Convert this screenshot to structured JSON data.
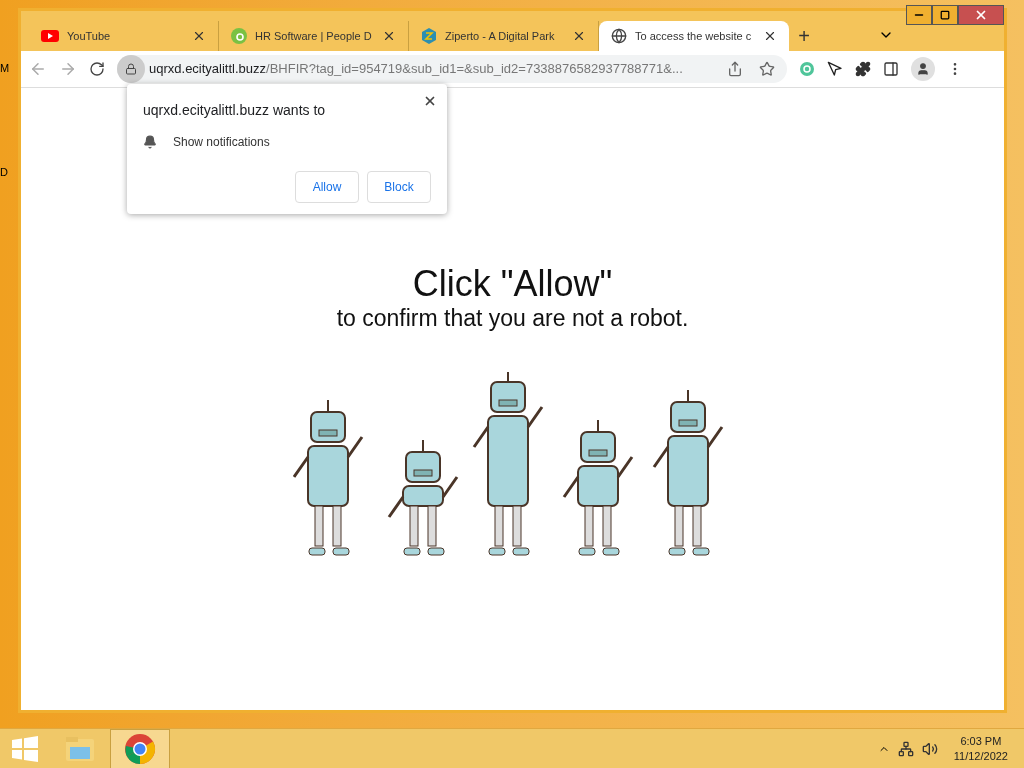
{
  "desktop": {
    "edge_labels": [
      "M",
      "D"
    ]
  },
  "tabs": [
    {
      "title": "YouTube",
      "selected": false
    },
    {
      "title": "HR Software | People D",
      "selected": false
    },
    {
      "title": "Ziperto - A Digital Park",
      "selected": false
    },
    {
      "title": "To access the website c",
      "selected": true
    }
  ],
  "new_tab": "+",
  "address": {
    "host": "uqrxd.ecityalittl.buzz",
    "path": "/BHFIR?tag_id=954719&sub_id1=&sub_id2=7338876582937788771&..."
  },
  "prompt": {
    "title": "uqrxd.ecityalittl.buzz wants to",
    "permission": "Show notifications",
    "buttons": [
      "Allow",
      "Block"
    ]
  },
  "page": {
    "heading": "Click \"Allow\"",
    "subheading": "to confirm that you are not a robot."
  },
  "taskbar": {
    "time": "6:03 PM",
    "date": "11/12/2022"
  }
}
